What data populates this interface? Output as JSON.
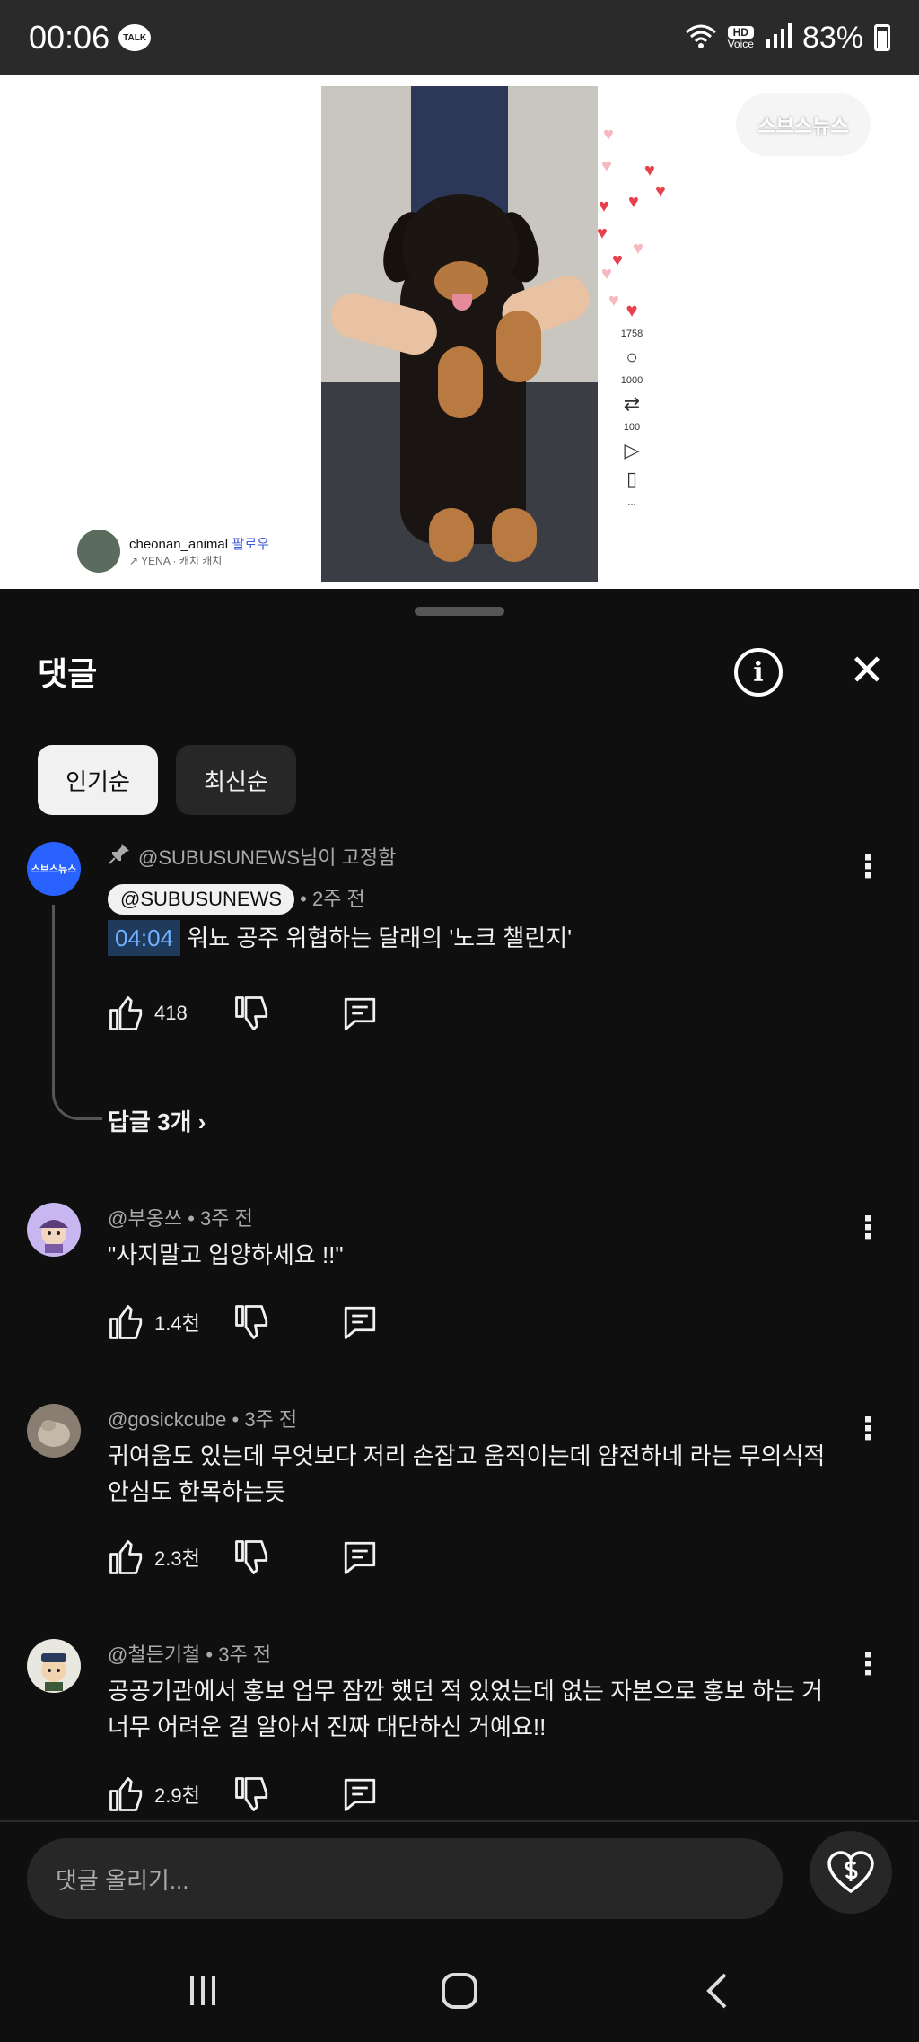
{
  "status_bar": {
    "time": "00:06",
    "talk_badge": "TALK",
    "hd_label": "HD",
    "voice_label": "Voice",
    "battery": "83%"
  },
  "video": {
    "channel_name": "cheonan_animal",
    "follow_label": "팔로우",
    "audio_label": "↗ YENA · 캐치 캐치",
    "watermark": "스브스뉴스",
    "likes_count": "1758",
    "comments_count": "1000",
    "shares_count": "100",
    "more_label": "..."
  },
  "sheet": {
    "title": "댓글",
    "sort_chips": [
      "인기순",
      "최신순"
    ]
  },
  "pinned_comment": {
    "pin_text": "@SUBUSUNEWS님이 고정함",
    "author": "@SUBUSUNEWS",
    "time": "• 2주 전",
    "timestamp": "04:04",
    "text": "워뇨 공주 위협하는 달래의 '노크 챌린지'",
    "likes": "418",
    "replies_label": "답글 3개"
  },
  "comments": [
    {
      "author": "@부옹쓰",
      "time": "• 3주 전",
      "text": "\"사지말고 입양하세요 !!\"",
      "likes": "1.4천"
    },
    {
      "author": "@gosickcube",
      "time": "• 3주 전",
      "text": "귀여움도 있는데 무엇보다 저리 손잡고 움직이는데 얌전하네 라는 무의식적 안심도 한목하는듯",
      "likes": "2.3천"
    },
    {
      "author": "@철든기철",
      "time": "• 3주 전",
      "text": "공공기관에서 홍보 업무 잠깐 했던 적 있었는데 없는 자본으로 홍보 하는 거 너무 어려운 걸 알아서 진짜 대단하신 거예요!!",
      "likes": "2.9천"
    }
  ],
  "input": {
    "placeholder": "댓글 올리기..."
  },
  "colors": {
    "background": "#0f0f0f",
    "chip_active": "#f1f1f1",
    "chip_inactive": "#272727",
    "timestamp_link": "#6fb1ff",
    "avatar_pinned": "#2962ff"
  }
}
